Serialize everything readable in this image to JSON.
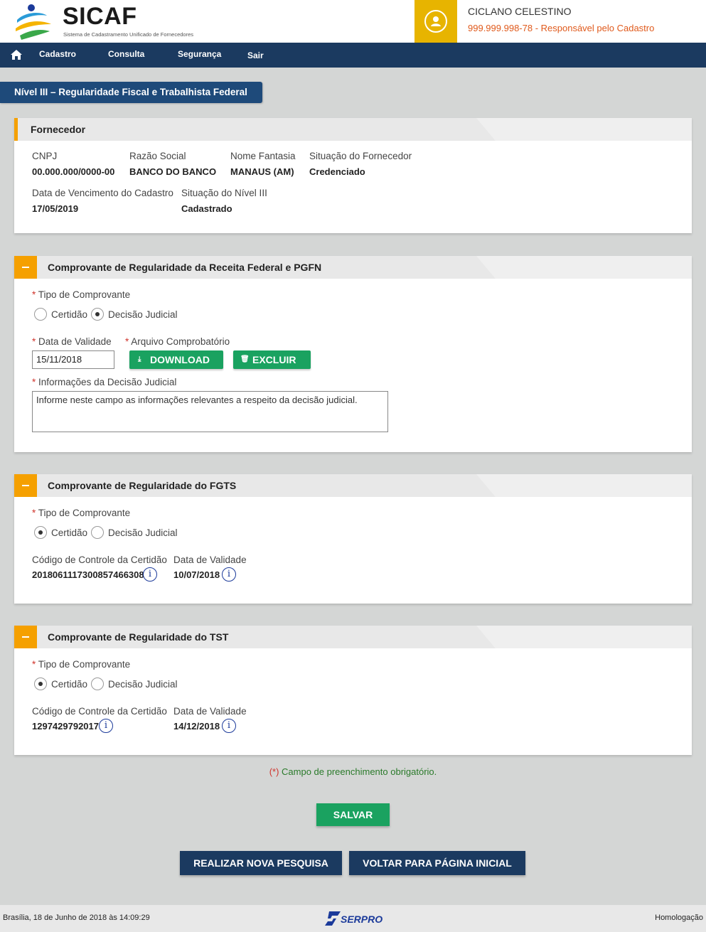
{
  "app": {
    "logo_title": "SICAF",
    "logo_subtitle": "Sistema de Cadastramento Unificado de Fornecedores"
  },
  "user": {
    "name": "CICLANO CELESTINO",
    "cpf": "999.999.998-78",
    "role": " - Responsável pelo Cadastro"
  },
  "nav": {
    "items": [
      "Cadastro",
      "Consulta",
      "Segurança",
      "Sair"
    ]
  },
  "page_title": "Nível III – Regularidade Fiscal e Trabalhista Federal",
  "fornecedor": {
    "title": "Fornecedor",
    "fields": [
      {
        "label": "CNPJ",
        "value": "00.000.000/0000-00"
      },
      {
        "label": "Razão Social",
        "value": "BANCO DO BANCO"
      },
      {
        "label": "Nome Fantasia",
        "value": "MANAUS (AM)"
      },
      {
        "label": "Situação do Fornecedor",
        "value": "Credenciado"
      },
      {
        "label": "Data de Vencimento do Cadastro",
        "value": "17/05/2019"
      },
      {
        "label": "Situação do Nível III",
        "value": "Cadastrado"
      }
    ]
  },
  "receita": {
    "title": "Comprovante de Regularidade da Receita Federal e PGFN",
    "tipo_label": "Tipo de Comprovante",
    "option_certidao": "Certidão",
    "option_decisao": "Decisão Judicial",
    "selected": "Decisão Judicial",
    "data_validade_label": "Data de Validade",
    "data_validade_value": "15/11/2018",
    "arquivo_label": "Arquivo Comprobatório",
    "download_label": "DOWNLOAD",
    "excluir_label": "EXCLUIR",
    "info_label": "Informações da Decisão Judicial",
    "info_value": "Informe neste campo as informações relevantes a respeito da decisão judicial."
  },
  "fgts": {
    "title": "Comprovante de Regularidade do FGTS",
    "tipo_label": "Tipo de Comprovante",
    "option_certidao": "Certidão",
    "option_decisao": "Decisão Judicial",
    "selected": "Certidão",
    "codigo_label": "Código de Controle da Certidão",
    "codigo_value": "2018061117300857466308",
    "data_label": "Data de Validade",
    "data_value": "10/07/2018"
  },
  "tst": {
    "title": "Comprovante de Regularidade do TST",
    "tipo_label": "Tipo de Comprovante",
    "option_certidao": "Certidão",
    "option_decisao": "Decisão Judicial",
    "selected": "Certidão",
    "codigo_label": "Código de Controle da Certidão",
    "codigo_value": "1297429792017",
    "data_label": "Data de Validade",
    "data_value": "14/12/2018"
  },
  "required_mark": "*",
  "mandatory_note_mark": "(*)",
  "mandatory_note_text": " Campo de preenchimento obrigatório.",
  "buttons": {
    "save": "SALVAR",
    "new_search": "REALIZAR NOVA PESQUISA",
    "back_home": "VOLTAR PARA PÁGINA INICIAL"
  },
  "footer": {
    "datetime": "Brasília, 18 de Junho de 2018 às 14:09:29",
    "logo": "SERPRO",
    "environment": "Homologação"
  },
  "colors": {
    "navy": "#1b3a60",
    "orange": "#f5a000",
    "green": "#1aa260",
    "user_box": "#e7b400"
  }
}
